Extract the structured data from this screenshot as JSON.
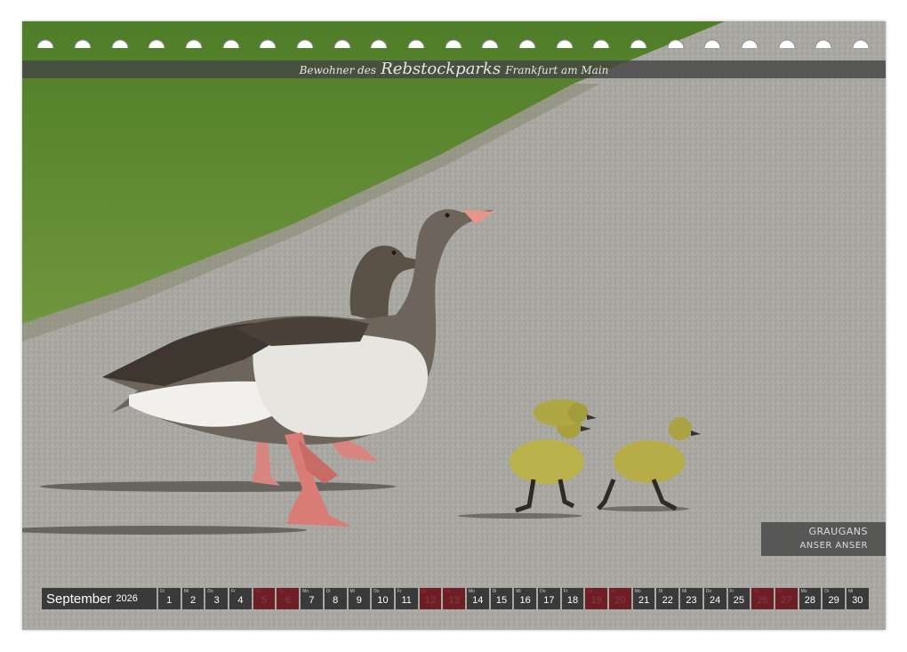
{
  "banner": {
    "prefix": "Bewohner des",
    "park": "Rebstockparks",
    "suffix": "Frankfurt am Main"
  },
  "species": {
    "german_name": "GRAUGANS",
    "latin_name": "ANSER ANSER"
  },
  "calendar": {
    "month": "September",
    "year": "2026",
    "days": [
      {
        "wd": "Di",
        "n": "1",
        "we": false
      },
      {
        "wd": "Mi",
        "n": "2",
        "we": false
      },
      {
        "wd": "Do",
        "n": "3",
        "we": false
      },
      {
        "wd": "Fr",
        "n": "4",
        "we": false
      },
      {
        "wd": "Sa",
        "n": "5",
        "we": true
      },
      {
        "wd": "So",
        "n": "6",
        "we": true
      },
      {
        "wd": "Mo",
        "n": "7",
        "we": false
      },
      {
        "wd": "Di",
        "n": "8",
        "we": false
      },
      {
        "wd": "Mi",
        "n": "9",
        "we": false
      },
      {
        "wd": "Do",
        "n": "10",
        "we": false
      },
      {
        "wd": "Fr",
        "n": "11",
        "we": false
      },
      {
        "wd": "Sa",
        "n": "12",
        "we": true
      },
      {
        "wd": "So",
        "n": "13",
        "we": true
      },
      {
        "wd": "Mo",
        "n": "14",
        "we": false
      },
      {
        "wd": "Di",
        "n": "15",
        "we": false
      },
      {
        "wd": "Mi",
        "n": "16",
        "we": false
      },
      {
        "wd": "Do",
        "n": "17",
        "we": false
      },
      {
        "wd": "Fr",
        "n": "18",
        "we": false
      },
      {
        "wd": "Sa",
        "n": "19",
        "we": true
      },
      {
        "wd": "So",
        "n": "20",
        "we": true
      },
      {
        "wd": "Mo",
        "n": "21",
        "we": false
      },
      {
        "wd": "Di",
        "n": "22",
        "we": false
      },
      {
        "wd": "Mi",
        "n": "23",
        "we": false
      },
      {
        "wd": "Do",
        "n": "24",
        "we": false
      },
      {
        "wd": "Fr",
        "n": "25",
        "we": false
      },
      {
        "wd": "Sa",
        "n": "26",
        "we": true
      },
      {
        "wd": "So",
        "n": "27",
        "we": true
      },
      {
        "wd": "Mo",
        "n": "28",
        "we": false
      },
      {
        "wd": "Di",
        "n": "29",
        "we": false
      },
      {
        "wd": "Mi",
        "n": "30",
        "we": false
      }
    ]
  },
  "colors": {
    "grass": "#5d8a2e",
    "path": "#a9a8a3",
    "weekend": "#6e1f25",
    "weekday": "#3a3a3a"
  }
}
